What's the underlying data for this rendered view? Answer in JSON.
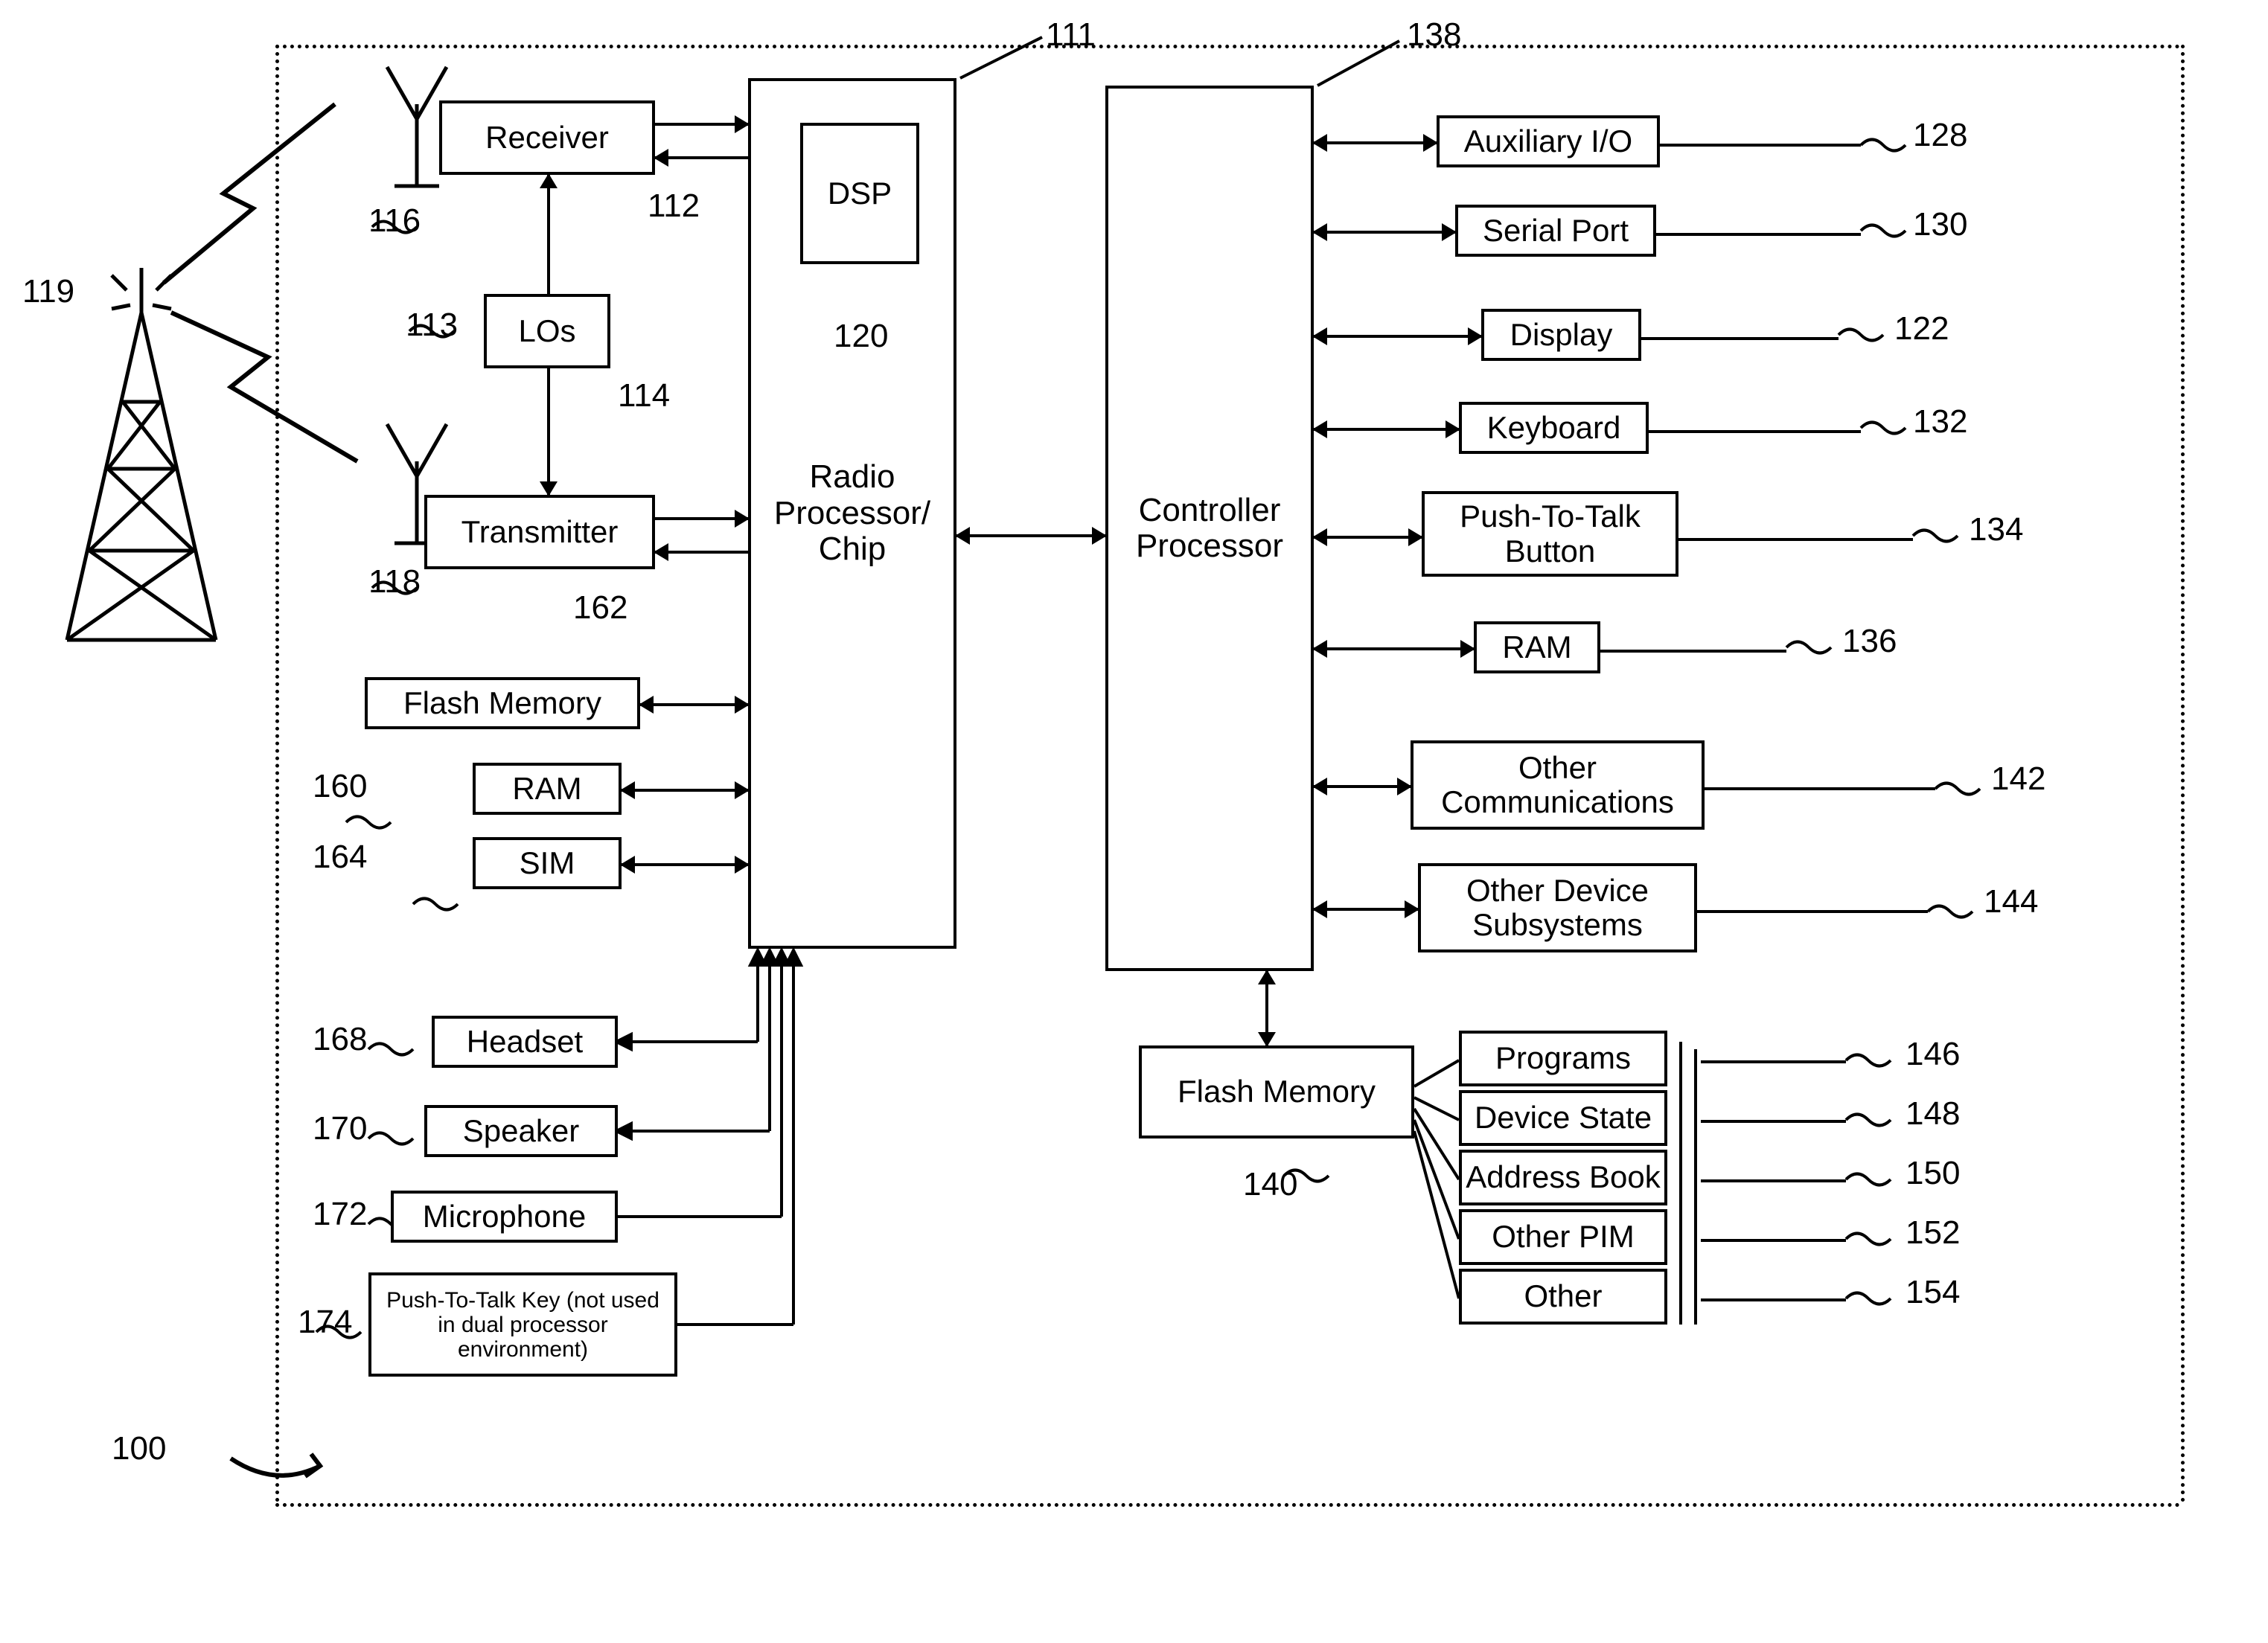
{
  "system_ref": "100",
  "tower_ref": "119",
  "radio_chip": {
    "label": "Radio\nProcessor/\nChip",
    "ref": "111"
  },
  "dsp": {
    "label": "DSP",
    "ref": "120"
  },
  "controller": {
    "label": "Controller\nProcessor",
    "ref": "138"
  },
  "receiver": {
    "label": "Receiver",
    "ref": "112",
    "antenna_ref": "116"
  },
  "los": {
    "label": "LOs",
    "ref": "113"
  },
  "transmitter": {
    "label": "Transmitter",
    "ref": "114",
    "antenna_ref": "118"
  },
  "flash_radio": {
    "label": "Flash Memory",
    "ref": "162"
  },
  "ram_radio": {
    "label": "RAM",
    "ref": "160"
  },
  "sim": {
    "label": "SIM",
    "ref": "164"
  },
  "headset": {
    "label": "Headset",
    "ref": "168"
  },
  "speaker": {
    "label": "Speaker",
    "ref": "170"
  },
  "microphone": {
    "label": "Microphone",
    "ref": "172"
  },
  "ptt_key": {
    "label": "Push-To-Talk Key (not used in dual processor environment)",
    "ref": "174"
  },
  "aux_io": {
    "label": "Auxiliary I/O",
    "ref": "128"
  },
  "serial_port": {
    "label": "Serial Port",
    "ref": "130"
  },
  "display": {
    "label": "Display",
    "ref": "122"
  },
  "keyboard": {
    "label": "Keyboard",
    "ref": "132"
  },
  "ptt_button": {
    "label": "Push-To-Talk\nButton",
    "ref": "134"
  },
  "ram_ctrl": {
    "label": "RAM",
    "ref": "136"
  },
  "other_comms": {
    "label": "Other\nCommunications",
    "ref": "142"
  },
  "other_subsys": {
    "label": "Other Device\nSubsystems",
    "ref": "144"
  },
  "flash_ctrl": {
    "label": "Flash Memory",
    "ref": "140"
  },
  "flash_parts": {
    "programs": {
      "label": "Programs",
      "ref": "146"
    },
    "device_state": {
      "label": "Device State",
      "ref": "148"
    },
    "address_book": {
      "label": "Address Book",
      "ref": "150"
    },
    "other_pim": {
      "label": "Other PIM",
      "ref": "152"
    },
    "other": {
      "label": "Other",
      "ref": "154"
    }
  }
}
